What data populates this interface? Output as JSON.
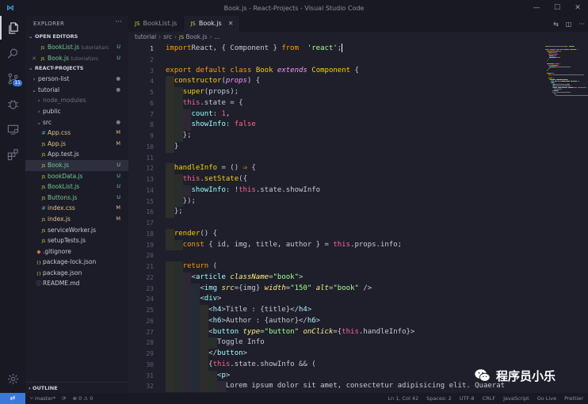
{
  "window": {
    "title": "Book.js - React-Projects - Visual Studio Code",
    "menu": [
      "File",
      "Edit",
      "Selection",
      "View",
      "Go",
      "Debug",
      "Terminal",
      "Help"
    ]
  },
  "activity_bar": {
    "items": [
      {
        "name": "explorer",
        "icon": "files-icon"
      },
      {
        "name": "search",
        "icon": "search-icon"
      },
      {
        "name": "source-control",
        "icon": "source-control-icon",
        "badge": "11"
      },
      {
        "name": "debug",
        "icon": "bug-icon"
      },
      {
        "name": "remote",
        "icon": "remote-explorer-icon"
      },
      {
        "name": "extensions",
        "icon": "extensions-icon"
      }
    ],
    "bottom": {
      "icon": "gear-icon"
    }
  },
  "sidebar": {
    "title": "EXPLORER",
    "open_editors": {
      "header": "OPEN EDITORS",
      "items": [
        {
          "name": "BookList.js",
          "path": "tutorial\\src",
          "status": "U",
          "close": ""
        },
        {
          "name": "Book.js",
          "path": "tutorial\\src",
          "status": "U",
          "close": "✕"
        }
      ]
    },
    "project": {
      "header": "REACT-PROJECTS",
      "items": [
        {
          "name": "person-list",
          "type": "folder",
          "status": "●",
          "indent": 0
        },
        {
          "name": "tutorial",
          "type": "folder-open",
          "status": "●",
          "indent": 0
        },
        {
          "name": "node_modules",
          "type": "folder",
          "status": "",
          "indent": 1
        },
        {
          "name": "public",
          "type": "folder",
          "status": "",
          "indent": 1
        },
        {
          "name": "src",
          "type": "folder-open",
          "status": "●",
          "indent": 1
        },
        {
          "name": "App.css",
          "type": "css",
          "status": "M",
          "indent": 2
        },
        {
          "name": "App.js",
          "type": "js",
          "status": "M",
          "indent": 2
        },
        {
          "name": "App.test.js",
          "type": "js",
          "status": "",
          "indent": 2
        },
        {
          "name": "Book.js",
          "type": "js",
          "status": "U",
          "indent": 2
        },
        {
          "name": "bookData.js",
          "type": "js",
          "status": "U",
          "indent": 2
        },
        {
          "name": "BookList.js",
          "type": "js",
          "status": "U",
          "indent": 2
        },
        {
          "name": "Buttons.js",
          "type": "js",
          "status": "U",
          "indent": 2
        },
        {
          "name": "index.css",
          "type": "css",
          "status": "M",
          "indent": 2
        },
        {
          "name": "index.js",
          "type": "js",
          "status": "M",
          "indent": 2
        },
        {
          "name": "serviceWorker.js",
          "type": "js",
          "status": "",
          "indent": 2
        },
        {
          "name": "setupTests.js",
          "type": "js",
          "status": "",
          "indent": 2
        },
        {
          "name": ".gitignore",
          "type": "git",
          "status": "",
          "indent": 1
        },
        {
          "name": "package-lock.json",
          "type": "json",
          "status": "",
          "indent": 1
        },
        {
          "name": "package.json",
          "type": "json",
          "status": "",
          "indent": 1
        },
        {
          "name": "README.md",
          "type": "md",
          "status": "",
          "indent": 1
        }
      ]
    },
    "outline_header": "OUTLINE"
  },
  "tabs": [
    {
      "label": "BookList.js",
      "active": false
    },
    {
      "label": "Book.js",
      "active": true
    }
  ],
  "breadcrumb": [
    "tutorial",
    "src",
    "Book.js",
    "..."
  ],
  "code": {
    "current_line": 1,
    "lines": [
      [
        [
          "k",
          "import"
        ],
        [
          "",
          "React, { Component } "
        ],
        [
          "k",
          "from"
        ],
        [
          "",
          "  "
        ],
        [
          "s",
          "'react'"
        ],
        [
          "",
          ";"
        ]
      ],
      [],
      [
        [
          "k",
          "export"
        ],
        [
          "",
          " "
        ],
        [
          "k",
          "default"
        ],
        [
          "",
          " "
        ],
        [
          "k",
          "class"
        ],
        [
          "",
          " "
        ],
        [
          "cls",
          "Book"
        ],
        [
          "",
          " "
        ],
        [
          "it",
          "extends"
        ],
        [
          "",
          " "
        ],
        [
          "cls",
          "Component"
        ],
        [
          "",
          " {"
        ]
      ],
      [
        [
          "",
          "  "
        ],
        [
          "fn",
          "constructor"
        ],
        [
          "",
          "("
        ],
        [
          "it",
          "props"
        ],
        [
          "",
          ") {"
        ]
      ],
      [
        [
          "",
          "    "
        ],
        [
          "fn",
          "super"
        ],
        [
          "",
          "(props);"
        ]
      ],
      [
        [
          "",
          "    "
        ],
        [
          "ob",
          "this"
        ],
        [
          "",
          ".state = {"
        ]
      ],
      [
        [
          "",
          "      "
        ],
        [
          "pr",
          "count"
        ],
        [
          "",
          ": "
        ],
        [
          "ob",
          "1"
        ],
        [
          "",
          ","
        ]
      ],
      [
        [
          "",
          "      "
        ],
        [
          "pr",
          "showInfo"
        ],
        [
          "",
          ": "
        ],
        [
          "ob",
          "false"
        ]
      ],
      [
        [
          "",
          "    };"
        ]
      ],
      [
        [
          "",
          "  }"
        ]
      ],
      [],
      [
        [
          "",
          "  "
        ],
        [
          "fn",
          "handleInfo"
        ],
        [
          "",
          " = () "
        ],
        [
          "k",
          "⇒"
        ],
        [
          "",
          " {"
        ]
      ],
      [
        [
          "",
          "    "
        ],
        [
          "ob",
          "this"
        ],
        [
          "",
          "."
        ],
        [
          "fn",
          "setState"
        ],
        [
          "",
          "({"
        ]
      ],
      [
        [
          "",
          "      "
        ],
        [
          "pr",
          "showInfo"
        ],
        [
          "",
          ": !"
        ],
        [
          "ob",
          "this"
        ],
        [
          "",
          ".state.showInfo"
        ]
      ],
      [
        [
          "",
          "    });"
        ]
      ],
      [
        [
          "",
          "  };"
        ]
      ],
      [],
      [
        [
          "",
          "  "
        ],
        [
          "fn",
          "render"
        ],
        [
          "",
          "() {"
        ]
      ],
      [
        [
          "",
          "    "
        ],
        [
          "k",
          "const"
        ],
        [
          "",
          " { id, img, title, author } = "
        ],
        [
          "ob",
          "this"
        ],
        [
          "",
          ".props.info;"
        ]
      ],
      [],
      [
        [
          "",
          "    "
        ],
        [
          "k",
          "return"
        ],
        [
          "",
          " ("
        ]
      ],
      [
        [
          "",
          "      <"
        ],
        [
          "tg",
          "article"
        ],
        [
          "",
          " "
        ],
        [
          "at",
          "className"
        ],
        [
          "",
          "="
        ],
        [
          "s",
          "\"book\""
        ],
        [
          "",
          ">"
        ]
      ],
      [
        [
          "",
          "        <"
        ],
        [
          "tg",
          "img"
        ],
        [
          "",
          " "
        ],
        [
          "at",
          "src"
        ],
        [
          "",
          "={img} "
        ],
        [
          "at",
          "width"
        ],
        [
          "",
          "="
        ],
        [
          "s",
          "\"150\""
        ],
        [
          "",
          " "
        ],
        [
          "at",
          "alt"
        ],
        [
          "",
          "="
        ],
        [
          "s",
          "\"book\""
        ],
        [
          "",
          " />"
        ]
      ],
      [
        [
          "",
          "        <"
        ],
        [
          "tg",
          "div"
        ],
        [
          "",
          ">"
        ]
      ],
      [
        [
          "",
          "          <"
        ],
        [
          "tg",
          "h4"
        ],
        [
          "",
          ">Title : {title}</"
        ],
        [
          "tg",
          "h4"
        ],
        [
          "",
          ">"
        ]
      ],
      [
        [
          "",
          "          <"
        ],
        [
          "tg",
          "h6"
        ],
        [
          "",
          ">Author : {author}</"
        ],
        [
          "tg",
          "h6"
        ],
        [
          "",
          ">"
        ]
      ],
      [
        [
          "",
          "          <"
        ],
        [
          "tg",
          "button"
        ],
        [
          "",
          " "
        ],
        [
          "at",
          "type"
        ],
        [
          "",
          "="
        ],
        [
          "s",
          "\"button\""
        ],
        [
          "",
          " "
        ],
        [
          "at",
          "onClick"
        ],
        [
          "",
          "={"
        ],
        [
          "ob",
          "this"
        ],
        [
          "",
          ".handleInfo}>"
        ]
      ],
      [
        [
          "",
          "            Toggle Info"
        ]
      ],
      [
        [
          "",
          "          </"
        ],
        [
          "tg",
          "button"
        ],
        [
          "",
          ">"
        ]
      ],
      [
        [
          "",
          "          {"
        ],
        [
          "ob",
          "this"
        ],
        [
          "",
          ".state.showInfo && ("
        ]
      ],
      [
        [
          "",
          "            <"
        ],
        [
          "tg",
          "p"
        ],
        [
          "",
          ">"
        ]
      ],
      [
        [
          "",
          "              Lorem ipsum dolor sit amet, consectetur adipisicing elit. Quaerat"
        ]
      ]
    ]
  },
  "status_bar": {
    "remote": "⇄",
    "left": [
      {
        "icon": "branch-icon",
        "text": "master*"
      },
      {
        "icon": "sync-icon",
        "text": ""
      },
      {
        "icon": "error-icon",
        "text": "⊗ 0  ⚠ 0"
      }
    ],
    "right": [
      "Ln 1, Col 42",
      "Spaces: 2",
      "UTF-8",
      "CRLF",
      "JavaScript",
      "Go Live",
      "Prettier"
    ]
  },
  "watermark": {
    "text": "程序员小乐"
  },
  "colors": {
    "editor_bg": "#1e1f2b",
    "accent": "#3a79d8",
    "keyword": "#ff9d00",
    "string": "#a5ff90",
    "function": "#fad000",
    "untracked": "#73c991",
    "modified": "#e2c08d"
  }
}
